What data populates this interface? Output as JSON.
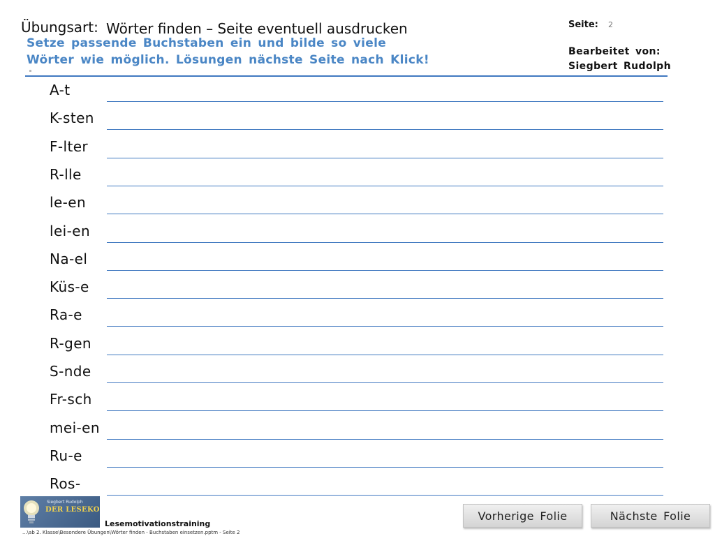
{
  "header": {
    "uebungsart_label": "Übungsart:",
    "title": "Wörter finden – Seite eventuell ausdrucken",
    "instruction_line1": "Setze passende Buchstaben ein und bilde so viele",
    "instruction_line2": "Wörter wie möglich. Lösungen nächste Seite nach Klick!",
    "seite_label": "Seite:",
    "seite_number": "2",
    "bearbeitet_label": "Bearbeitet von:",
    "author": "Siegbert Rudolph"
  },
  "words": [
    "A-t",
    "K-sten",
    "F-lter",
    "R-lle",
    "le-en",
    "lei-en",
    "Na-el",
    "Küs-e",
    "Ra-e",
    "R-gen",
    "S-nde",
    "Fr-sch",
    "mei-en",
    "Ru-e",
    "Ros-"
  ],
  "footer": {
    "logo_name": "Siegbert Rudolph",
    "logo_brand": "DER LESEKOCH",
    "program_label": "Lesemotivationstraining",
    "file_path": "...\\ab 2. Klasse\\Besondere Übungen\\Wörter finden - Buchstaben einsetzen.pptm - Seite 2"
  },
  "nav": {
    "prev_label": "Vorherige Folie",
    "next_label": "Nächste Folie"
  },
  "colors": {
    "accent_blue": "#4a86c5",
    "rule_blue": "#3f78c0",
    "logo_bg": "#4b6b93",
    "logo_brand": "#f2d24b"
  }
}
